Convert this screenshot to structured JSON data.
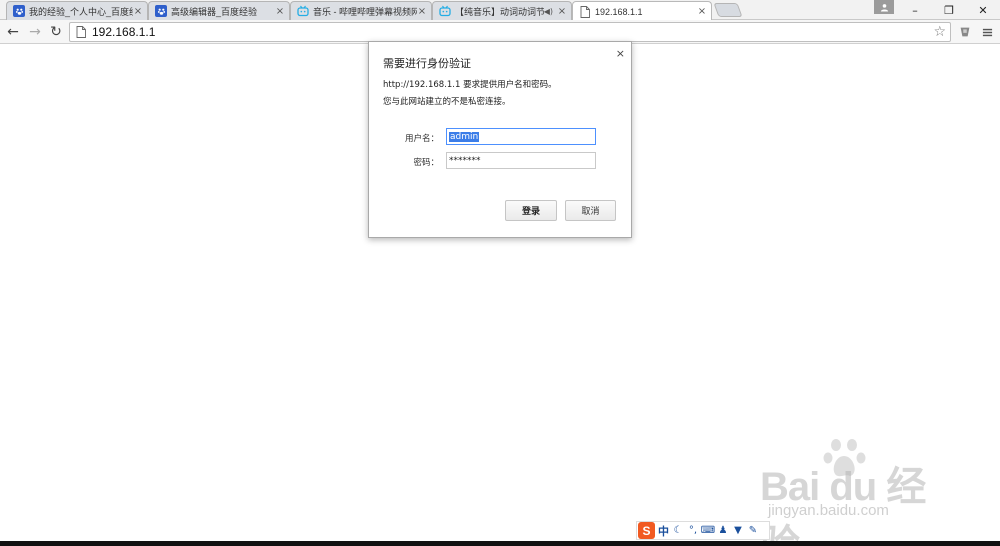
{
  "tabs": [
    {
      "title": "我的经验_个人中心_百度经验",
      "icon": "baidu-paw-icon"
    },
    {
      "title": "高级编辑器_百度经验",
      "icon": "baidu-paw-icon"
    },
    {
      "title": "音乐 - 哔哩哔哩弹幕视频网",
      "icon": "bilibili-tv-icon"
    },
    {
      "title": "【纯音乐】动词动词节奏",
      "icon": "bilibili-tv-icon",
      "audio": "◀)"
    },
    {
      "title": "192.168.1.1",
      "icon": "page-icon",
      "active": true
    }
  ],
  "address_bar": {
    "url": "192.168.1.1"
  },
  "dialog": {
    "title": "需要进行身份验证",
    "message_line1": "http://192.168.1.1 要求提供用户名和密码。",
    "message_line2": "您与此网站建立的不是私密连接。",
    "username_label": "用户名：",
    "username_value": "admin",
    "password_label": "密码：",
    "password_value": "*******",
    "login_label": "登录",
    "cancel_label": "取消"
  },
  "watermark": {
    "brand": "Bai du 经验",
    "url": "jingyan.baidu.com"
  },
  "ime": {
    "logo": "S",
    "mode": "中"
  },
  "colors": {
    "accent": "#4d90fe",
    "selection": "#3b7de8",
    "ime": "#f15a22",
    "paw": "#2f5fcb"
  }
}
